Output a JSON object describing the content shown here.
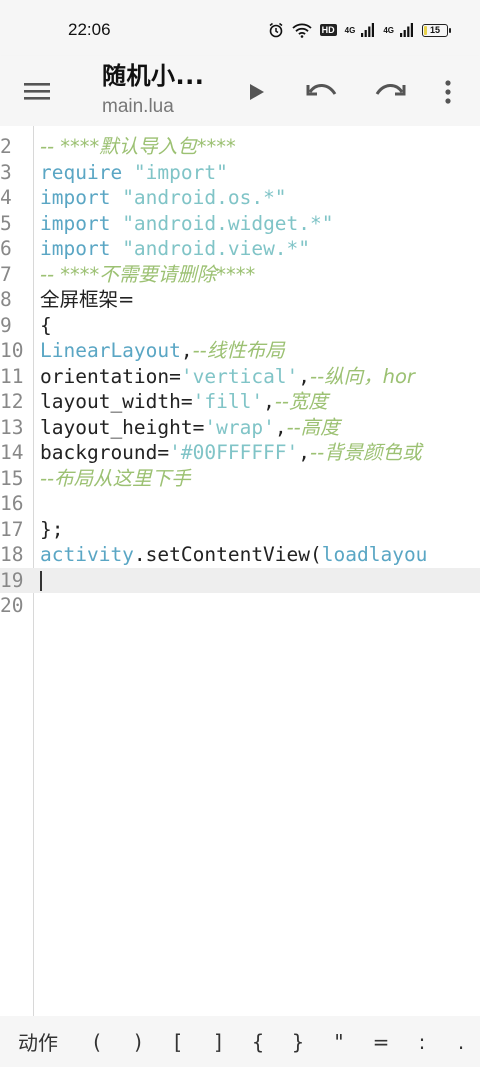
{
  "status": {
    "time": "22:06",
    "hd": "HD",
    "net1": "4G",
    "net2": "4G",
    "battery": "15",
    "battery_level_percent": 15
  },
  "toolbar": {
    "title": "随机小...",
    "subtitle": "main.lua",
    "icons": [
      "menu-icon",
      "play-icon",
      "undo-icon",
      "redo-icon",
      "more-vert-icon"
    ]
  },
  "editor": {
    "lines": [
      {
        "n": "2",
        "tokens": [
          {
            "t": "-- ****默认导入包****",
            "c": "comment"
          }
        ]
      },
      {
        "n": "3",
        "tokens": [
          {
            "t": "require ",
            "c": "kw"
          },
          {
            "t": "\"import\"",
            "c": "str"
          }
        ]
      },
      {
        "n": "4",
        "tokens": [
          {
            "t": "import ",
            "c": "kw"
          },
          {
            "t": "\"android.os.*\"",
            "c": "str"
          }
        ]
      },
      {
        "n": "5",
        "tokens": [
          {
            "t": "import ",
            "c": "kw"
          },
          {
            "t": "\"android.widget.*\"",
            "c": "str"
          }
        ]
      },
      {
        "n": "6",
        "tokens": [
          {
            "t": "import ",
            "c": "kw"
          },
          {
            "t": "\"android.view.*\"",
            "c": "str"
          }
        ]
      },
      {
        "n": "7",
        "tokens": [
          {
            "t": "-- ****不需要请删除****",
            "c": "comment"
          }
        ]
      },
      {
        "n": "8",
        "tokens": [
          {
            "t": "全屏框架=",
            "c": "plain"
          }
        ]
      },
      {
        "n": "9",
        "tokens": [
          {
            "t": "{",
            "c": "plain"
          }
        ]
      },
      {
        "n": "10",
        "tokens": [
          {
            "t": "LinearLayout",
            "c": "kw"
          },
          {
            "t": ",",
            "c": "plain"
          },
          {
            "t": "--线性布局",
            "c": "comment"
          }
        ]
      },
      {
        "n": "11",
        "tokens": [
          {
            "t": "orientation=",
            "c": "plain"
          },
          {
            "t": "'vertical'",
            "c": "str"
          },
          {
            "t": ",",
            "c": "plain"
          },
          {
            "t": "--纵向，hor",
            "c": "comment"
          }
        ]
      },
      {
        "n": "12",
        "tokens": [
          {
            "t": "layout_width=",
            "c": "plain"
          },
          {
            "t": "'fill'",
            "c": "str"
          },
          {
            "t": ",",
            "c": "plain"
          },
          {
            "t": "--宽度",
            "c": "comment"
          }
        ]
      },
      {
        "n": "13",
        "tokens": [
          {
            "t": "layout_height=",
            "c": "plain"
          },
          {
            "t": "'wrap'",
            "c": "str"
          },
          {
            "t": ",",
            "c": "plain"
          },
          {
            "t": "--高度",
            "c": "comment"
          }
        ]
      },
      {
        "n": "14",
        "tokens": [
          {
            "t": "background=",
            "c": "plain"
          },
          {
            "t": "'#00FFFFFF'",
            "c": "str"
          },
          {
            "t": ",",
            "c": "plain"
          },
          {
            "t": "--背景颜色或",
            "c": "comment"
          }
        ]
      },
      {
        "n": "15",
        "tokens": [
          {
            "t": "--布局从这里下手",
            "c": "comment"
          }
        ]
      },
      {
        "n": "16",
        "tokens": []
      },
      {
        "n": "17",
        "tokens": [
          {
            "t": "};",
            "c": "plain"
          }
        ]
      },
      {
        "n": "18",
        "tokens": [
          {
            "t": "activity",
            "c": "kw"
          },
          {
            "t": ".setContentView(",
            "c": "plain"
          },
          {
            "t": "loadlayou",
            "c": "kw"
          }
        ]
      },
      {
        "n": "19",
        "tokens": [],
        "current": true
      },
      {
        "n": "20",
        "tokens": []
      }
    ]
  },
  "symbols": {
    "items": [
      "动作",
      "(",
      ")",
      "[",
      "]",
      "{",
      "}",
      "\"",
      "=",
      ":",
      "."
    ]
  },
  "colors": {
    "comment": "#9cc173",
    "keyword": "#5aa6c4",
    "string": "#80c4c7",
    "current_line": "#eeeeee"
  }
}
